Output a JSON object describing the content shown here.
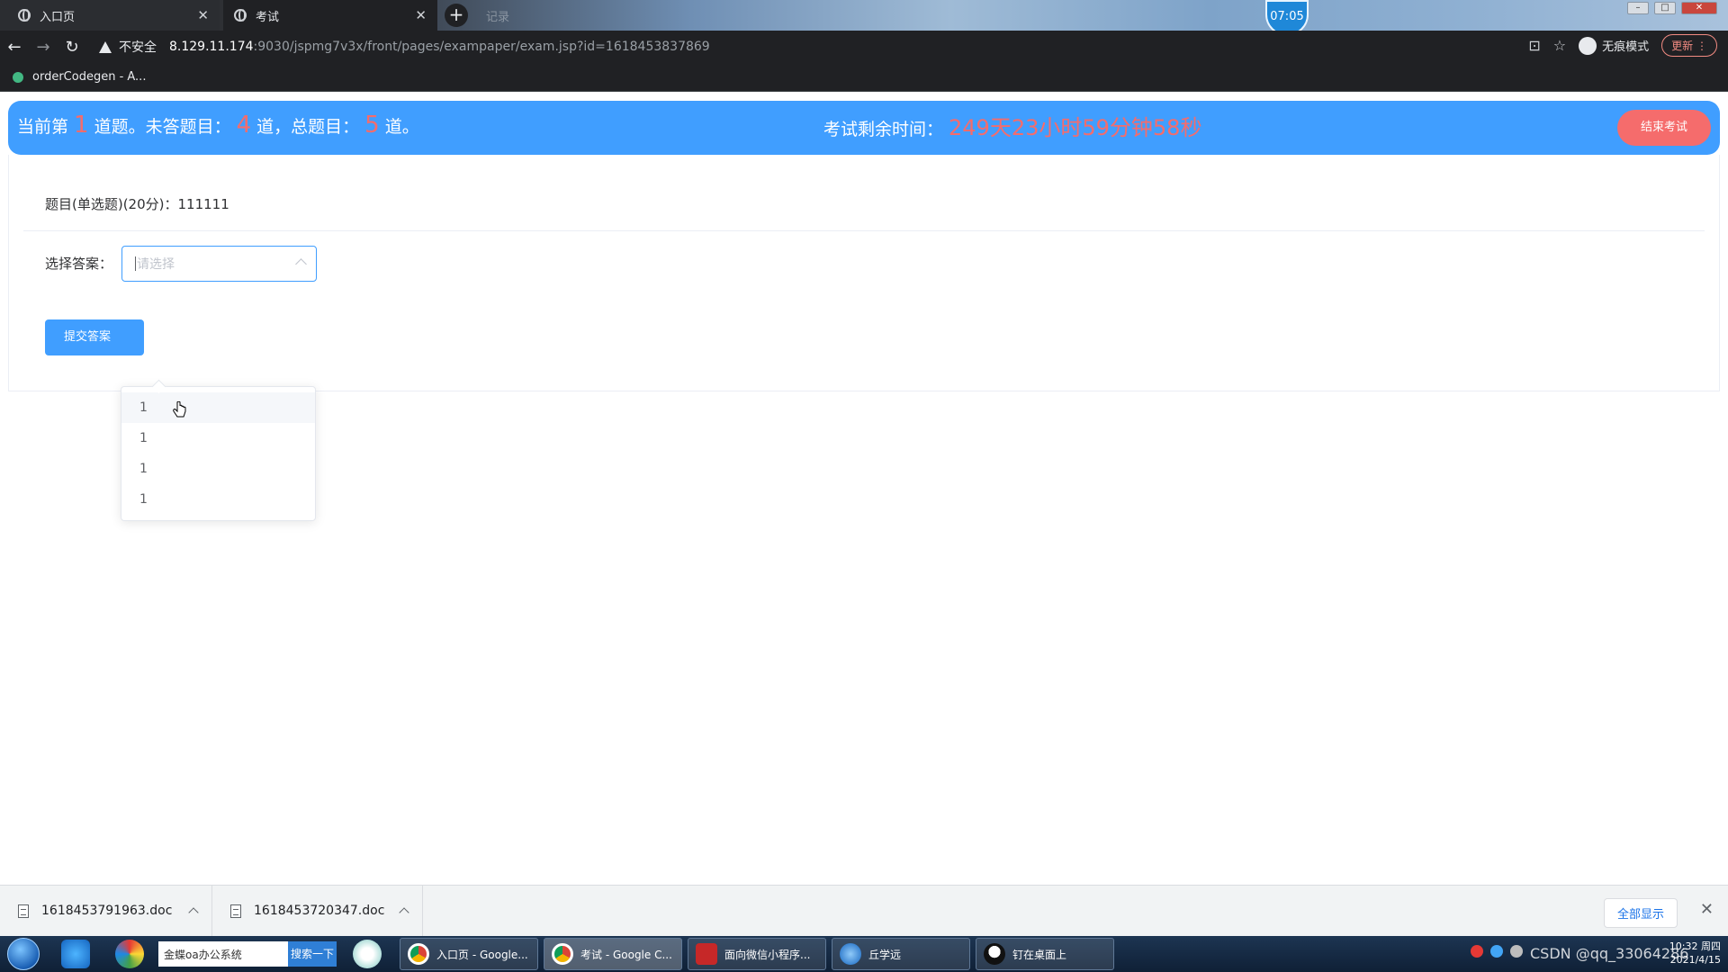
{
  "browser": {
    "tabs": [
      {
        "title": "入口页",
        "active": false
      },
      {
        "title": "考试",
        "active": true
      }
    ],
    "ghost_tab": "记录",
    "clock_bubble": "07:05",
    "window_controls": {
      "minimize": "–",
      "maximize": "□",
      "close": "✕"
    },
    "address": {
      "security_label": "不安全",
      "host": "8.129.11.174",
      "path": ":9030/jspmg7v3x/front/pages/exampaper/exam.jsp?id=1618453837869"
    },
    "incognito_label": "无痕模式",
    "update_label": "更新",
    "bookmark": "orderCodegen - A..."
  },
  "exam": {
    "current_prefix": "当前第",
    "current_number": "1",
    "current_suffix": "道题。未答题目：",
    "unanswered": "4",
    "unanswered_suffix": "道，总题目：",
    "total": "5",
    "total_suffix": "道。",
    "remaining_label": "考试剩余时间：",
    "remaining_time": "249天23小时59分钟58秒",
    "end_button": "结束考试"
  },
  "question": {
    "text": "题目(单选题)(20分)：111111",
    "answer_label": "选择答案：",
    "select_placeholder": "请选择",
    "options": [
      "1",
      "1",
      "1",
      "1"
    ],
    "submit_button": "提交答案"
  },
  "downloads": {
    "items": [
      "1618453791963.doc",
      "1618453720347.doc"
    ],
    "show_all": "全部显示"
  },
  "taskbar": {
    "search_text": "金蝶oa办公系统",
    "search_go": "搜索一下",
    "tasks": [
      {
        "label": "入口页 - Google...",
        "icon": "chrome-icon"
      },
      {
        "label": "考试 - Google C...",
        "icon": "chrome-icon"
      },
      {
        "label": "面向微信小程序...",
        "icon": "wps-icon"
      },
      {
        "label": "丘学远",
        "icon": "user-icon"
      },
      {
        "label": "钉在桌面上",
        "icon": "qq-icon"
      }
    ],
    "tray_watermark": "CSDN @qq_33064286",
    "time": "10:32 周四",
    "date": "2021/4/15"
  },
  "colors": {
    "primary": "#409eff",
    "danger": "#f56c6c"
  }
}
